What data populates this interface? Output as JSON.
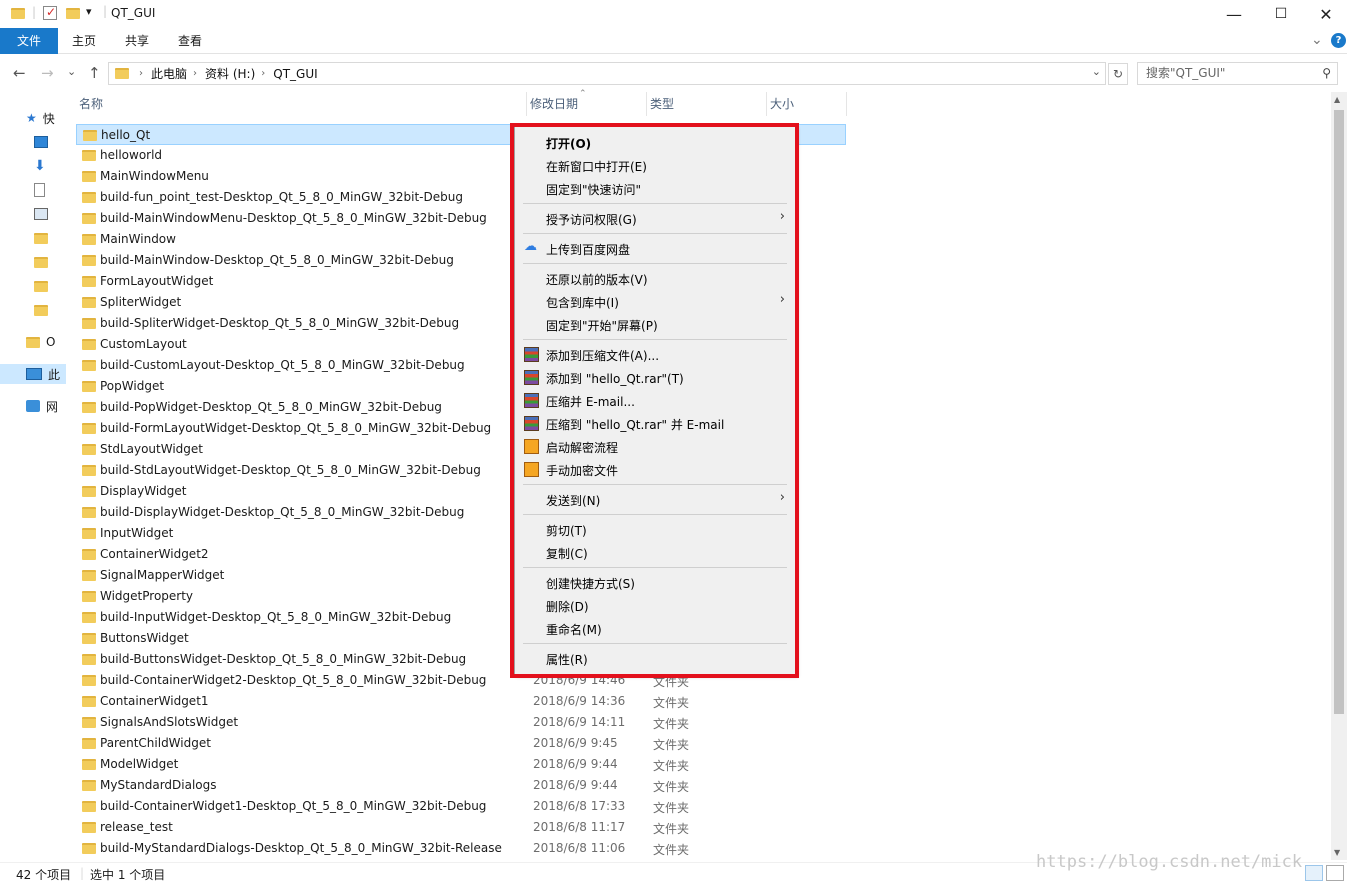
{
  "window": {
    "title": "QT_GUI",
    "quick_access_dropdown": "▾",
    "minimize": "—",
    "maximize": "☐",
    "close": "✕"
  },
  "ribbon": {
    "tabs": [
      "文件",
      "主页",
      "共享",
      "查看"
    ],
    "expand": "⌄",
    "help": "?"
  },
  "address": {
    "back": "←",
    "forward": "→",
    "recent": "⌄",
    "up": "↑",
    "crumbs": [
      "此电脑",
      "资料 (H:)",
      "QT_GUI"
    ],
    "separator": "›",
    "dropdown": "⌄",
    "refresh": "↻",
    "search_placeholder": "搜索\"QT_GUI\"",
    "search_icon": "⚲"
  },
  "nav": {
    "items": [
      {
        "label": "快",
        "icon": "star-icon"
      },
      {
        "label": "",
        "icon": "desktop-icon"
      },
      {
        "label": "",
        "icon": "download-icon"
      },
      {
        "label": "",
        "icon": "document-icon"
      },
      {
        "label": "",
        "icon": "picture-icon"
      },
      {
        "label": "",
        "icon": "folder-icon"
      },
      {
        "label": "",
        "icon": "folder-icon"
      },
      {
        "label": "",
        "icon": "folder-icon"
      },
      {
        "label": "",
        "icon": "folder-icon"
      },
      {
        "label": "O",
        "icon": "folder-icon"
      },
      {
        "label": "此",
        "icon": "computer-icon"
      },
      {
        "label": "网",
        "icon": "network-icon"
      }
    ]
  },
  "columns": {
    "name": "名称",
    "date": "修改日期",
    "type": "类型",
    "size": "大小",
    "sort_indicator": "⌃"
  },
  "files": [
    {
      "name": "hello_Qt",
      "date": "",
      "type": ""
    },
    {
      "name": "helloworld",
      "date": "",
      "type": ""
    },
    {
      "name": "MainWindowMenu",
      "date": "",
      "type": ""
    },
    {
      "name": "build-fun_point_test-Desktop_Qt_5_8_0_MinGW_32bit-Debug",
      "date": "",
      "type": ""
    },
    {
      "name": "build-MainWindowMenu-Desktop_Qt_5_8_0_MinGW_32bit-Debug",
      "date": "",
      "type": ""
    },
    {
      "name": "MainWindow",
      "date": "",
      "type": ""
    },
    {
      "name": "build-MainWindow-Desktop_Qt_5_8_0_MinGW_32bit-Debug",
      "date": "",
      "type": ""
    },
    {
      "name": "FormLayoutWidget",
      "date": "",
      "type": ""
    },
    {
      "name": "SpliterWidget",
      "date": "",
      "type": ""
    },
    {
      "name": "build-SpliterWidget-Desktop_Qt_5_8_0_MinGW_32bit-Debug",
      "date": "",
      "type": ""
    },
    {
      "name": "CustomLayout",
      "date": "",
      "type": ""
    },
    {
      "name": "build-CustomLayout-Desktop_Qt_5_8_0_MinGW_32bit-Debug",
      "date": "",
      "type": ""
    },
    {
      "name": "PopWidget",
      "date": "",
      "type": ""
    },
    {
      "name": "build-PopWidget-Desktop_Qt_5_8_0_MinGW_32bit-Debug",
      "date": "",
      "type": ""
    },
    {
      "name": "build-FormLayoutWidget-Desktop_Qt_5_8_0_MinGW_32bit-Debug",
      "date": "",
      "type": ""
    },
    {
      "name": "StdLayoutWidget",
      "date": "",
      "type": ""
    },
    {
      "name": "build-StdLayoutWidget-Desktop_Qt_5_8_0_MinGW_32bit-Debug",
      "date": "",
      "type": ""
    },
    {
      "name": "DisplayWidget",
      "date": "",
      "type": ""
    },
    {
      "name": "build-DisplayWidget-Desktop_Qt_5_8_0_MinGW_32bit-Debug",
      "date": "",
      "type": ""
    },
    {
      "name": "InputWidget",
      "date": "",
      "type": ""
    },
    {
      "name": "ContainerWidget2",
      "date": "",
      "type": ""
    },
    {
      "name": "SignalMapperWidget",
      "date": "",
      "type": ""
    },
    {
      "name": "WidgetProperty",
      "date": "",
      "type": ""
    },
    {
      "name": "build-InputWidget-Desktop_Qt_5_8_0_MinGW_32bit-Debug",
      "date": "",
      "type": ""
    },
    {
      "name": "ButtonsWidget",
      "date": "",
      "type": ""
    },
    {
      "name": "build-ButtonsWidget-Desktop_Qt_5_8_0_MinGW_32bit-Debug",
      "date": "",
      "type": ""
    },
    {
      "name": "build-ContainerWidget2-Desktop_Qt_5_8_0_MinGW_32bit-Debug",
      "date": "2018/6/9 14:46",
      "type": "文件夹"
    },
    {
      "name": "ContainerWidget1",
      "date": "2018/6/9 14:36",
      "type": "文件夹"
    },
    {
      "name": "SignalsAndSlotsWidget",
      "date": "2018/6/9 14:11",
      "type": "文件夹"
    },
    {
      "name": "ParentChildWidget",
      "date": "2018/6/9 9:45",
      "type": "文件夹"
    },
    {
      "name": "ModelWidget",
      "date": "2018/6/9 9:44",
      "type": "文件夹"
    },
    {
      "name": "MyStandardDialogs",
      "date": "2018/6/9 9:44",
      "type": "文件夹"
    },
    {
      "name": "build-ContainerWidget1-Desktop_Qt_5_8_0_MinGW_32bit-Debug",
      "date": "2018/6/8 17:33",
      "type": "文件夹"
    },
    {
      "name": "release_test",
      "date": "2018/6/8 11:17",
      "type": "文件夹"
    },
    {
      "name": "build-MyStandardDialogs-Desktop_Qt_5_8_0_MinGW_32bit-Release",
      "date": "2018/6/8 11:06",
      "type": "文件夹"
    }
  ],
  "context_menu": {
    "groups": [
      [
        {
          "label": "打开(O)",
          "bold": true,
          "icon": "",
          "submenu": false
        },
        {
          "label": "在新窗口中打开(E)",
          "icon": "",
          "submenu": false
        },
        {
          "label": "固定到\"快速访问\"",
          "icon": "",
          "submenu": false
        }
      ],
      [
        {
          "label": "授予访问权限(G)",
          "icon": "",
          "submenu": true
        }
      ],
      [
        {
          "label": "上传到百度网盘",
          "icon": "baidu-cloud-icon",
          "submenu": false
        }
      ],
      [
        {
          "label": "还原以前的版本(V)",
          "icon": "",
          "submenu": false
        },
        {
          "label": "包含到库中(I)",
          "icon": "",
          "submenu": true
        },
        {
          "label": "固定到\"开始\"屏幕(P)",
          "icon": "",
          "submenu": false
        }
      ],
      [
        {
          "label": "添加到压缩文件(A)...",
          "icon": "winrar-icon",
          "submenu": false
        },
        {
          "label": "添加到 \"hello_Qt.rar\"(T)",
          "icon": "winrar-icon",
          "submenu": false
        },
        {
          "label": "压缩并 E-mail...",
          "icon": "winrar-icon",
          "submenu": false
        },
        {
          "label": "压缩到 \"hello_Qt.rar\" 并 E-mail",
          "icon": "winrar-icon",
          "submenu": false
        },
        {
          "label": "启动解密流程",
          "icon": "encrypt-icon",
          "submenu": false
        },
        {
          "label": "手动加密文件",
          "icon": "encrypt-icon",
          "submenu": false
        }
      ],
      [
        {
          "label": "发送到(N)",
          "icon": "",
          "submenu": true
        }
      ],
      [
        {
          "label": "剪切(T)",
          "icon": "",
          "submenu": false
        },
        {
          "label": "复制(C)",
          "icon": "",
          "submenu": false
        }
      ],
      [
        {
          "label": "创建快捷方式(S)",
          "icon": "",
          "submenu": false
        },
        {
          "label": "删除(D)",
          "icon": "",
          "submenu": false
        },
        {
          "label": "重命名(M)",
          "icon": "",
          "submenu": false
        }
      ],
      [
        {
          "label": "属性(R)",
          "icon": "",
          "submenu": false
        }
      ]
    ],
    "submenu_arrow": "›",
    "highlight_color": "#e3101c"
  },
  "status": {
    "count": "42 个项目",
    "selected": "选中 1 个项目"
  },
  "watermark": "https://blog.csdn.net/mick",
  "colors": {
    "file_tab": "#1979ca",
    "selection": "#cce8ff",
    "folder": "#f2cc5b"
  }
}
